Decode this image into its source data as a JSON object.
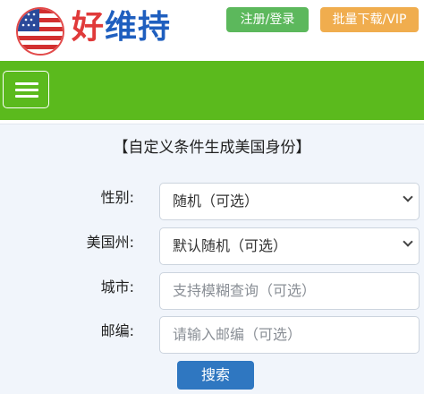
{
  "header": {
    "brand": "好维持",
    "login_label": "注册/登录",
    "vip_label": "批量下载/VIP"
  },
  "nav": {
    "menu_icon": "hamburger-menu-icon"
  },
  "form": {
    "title": "【自定义条件生成美国身份】",
    "fields": [
      {
        "label": "性别:",
        "value": "随机（可选）",
        "type": "select"
      },
      {
        "label": "美国州:",
        "value": "默认随机（可选）",
        "type": "select"
      },
      {
        "label": "城市:",
        "placeholder": "支持模糊查询（可选）",
        "type": "input"
      },
      {
        "label": "邮编:",
        "placeholder": "请输入邮编（可选）",
        "type": "input"
      }
    ],
    "submit_label": "搜索"
  },
  "colors": {
    "nav_green": "#5bba1d",
    "login_green": "#5cb85c",
    "vip_orange": "#f0ad4e",
    "search_blue": "#2f77c1",
    "brand_blue": "#1f5fbf",
    "brand_red": "#e03a3a"
  }
}
